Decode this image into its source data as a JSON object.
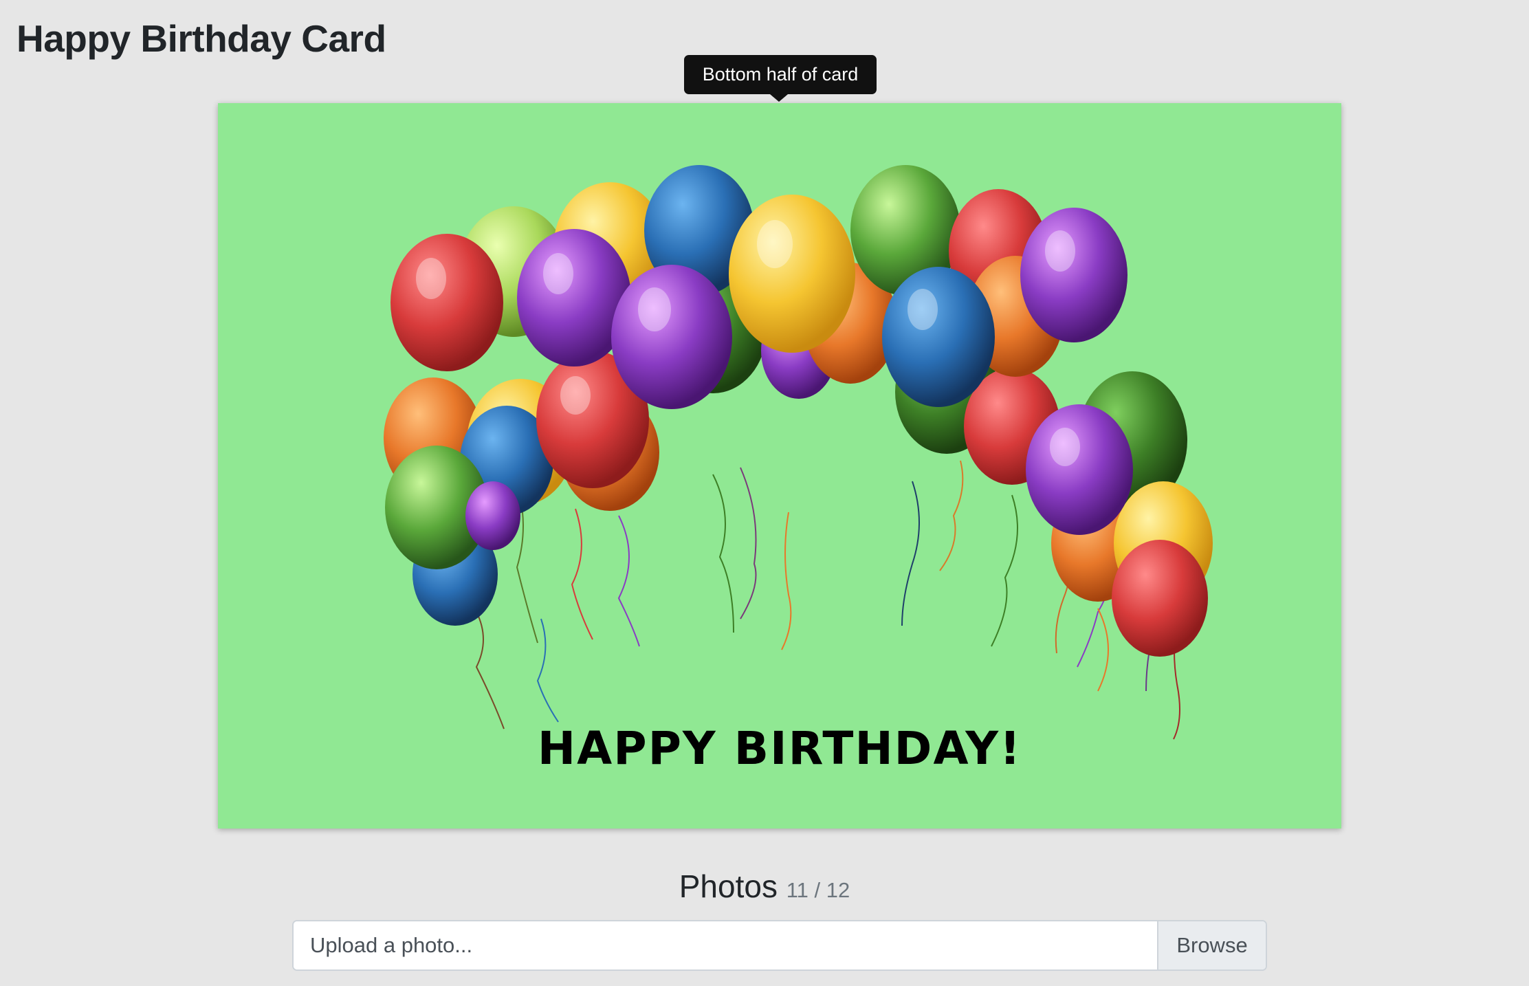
{
  "page": {
    "title": "Happy Birthday Card"
  },
  "tooltip": {
    "text": "Bottom half of card"
  },
  "card": {
    "background": "#90e893",
    "greeting": "HAPPY BIRTHDAY!",
    "image_description_icon": "balloons-icon"
  },
  "photos": {
    "heading": "Photos",
    "count": "11 / 12"
  },
  "upload": {
    "placeholder": "Upload a photo...",
    "browse_label": "Browse"
  },
  "colors": {
    "page_background": "#e6e6e6",
    "tooltip_background": "#111111",
    "balloon_red": "#d83b3b",
    "balloon_yellow": "#f5c531",
    "balloon_blue": "#2a6fb5",
    "balloon_green": "#5aa83a",
    "balloon_purple": "#8a3cc4",
    "balloon_orange": "#e8782a"
  }
}
